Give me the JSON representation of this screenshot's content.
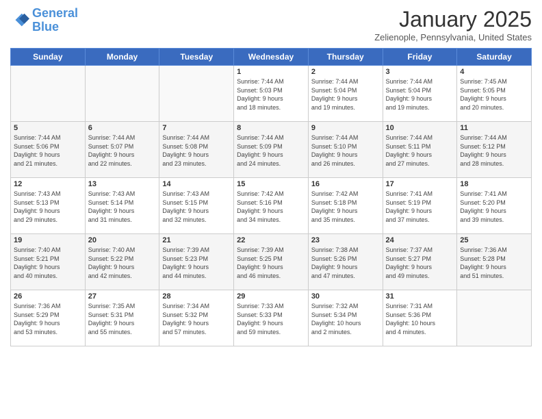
{
  "header": {
    "logo_line1": "General",
    "logo_line2": "Blue",
    "title": "January 2025",
    "location": "Zelienople, Pennsylvania, United States"
  },
  "days_of_week": [
    "Sunday",
    "Monday",
    "Tuesday",
    "Wednesday",
    "Thursday",
    "Friday",
    "Saturday"
  ],
  "weeks": [
    [
      {
        "day": "",
        "info": ""
      },
      {
        "day": "",
        "info": ""
      },
      {
        "day": "",
        "info": ""
      },
      {
        "day": "1",
        "info": "Sunrise: 7:44 AM\nSunset: 5:03 PM\nDaylight: 9 hours\nand 18 minutes."
      },
      {
        "day": "2",
        "info": "Sunrise: 7:44 AM\nSunset: 5:04 PM\nDaylight: 9 hours\nand 19 minutes."
      },
      {
        "day": "3",
        "info": "Sunrise: 7:44 AM\nSunset: 5:04 PM\nDaylight: 9 hours\nand 19 minutes."
      },
      {
        "day": "4",
        "info": "Sunrise: 7:45 AM\nSunset: 5:05 PM\nDaylight: 9 hours\nand 20 minutes."
      }
    ],
    [
      {
        "day": "5",
        "info": "Sunrise: 7:44 AM\nSunset: 5:06 PM\nDaylight: 9 hours\nand 21 minutes."
      },
      {
        "day": "6",
        "info": "Sunrise: 7:44 AM\nSunset: 5:07 PM\nDaylight: 9 hours\nand 22 minutes."
      },
      {
        "day": "7",
        "info": "Sunrise: 7:44 AM\nSunset: 5:08 PM\nDaylight: 9 hours\nand 23 minutes."
      },
      {
        "day": "8",
        "info": "Sunrise: 7:44 AM\nSunset: 5:09 PM\nDaylight: 9 hours\nand 24 minutes."
      },
      {
        "day": "9",
        "info": "Sunrise: 7:44 AM\nSunset: 5:10 PM\nDaylight: 9 hours\nand 26 minutes."
      },
      {
        "day": "10",
        "info": "Sunrise: 7:44 AM\nSunset: 5:11 PM\nDaylight: 9 hours\nand 27 minutes."
      },
      {
        "day": "11",
        "info": "Sunrise: 7:44 AM\nSunset: 5:12 PM\nDaylight: 9 hours\nand 28 minutes."
      }
    ],
    [
      {
        "day": "12",
        "info": "Sunrise: 7:43 AM\nSunset: 5:13 PM\nDaylight: 9 hours\nand 29 minutes."
      },
      {
        "day": "13",
        "info": "Sunrise: 7:43 AM\nSunset: 5:14 PM\nDaylight: 9 hours\nand 31 minutes."
      },
      {
        "day": "14",
        "info": "Sunrise: 7:43 AM\nSunset: 5:15 PM\nDaylight: 9 hours\nand 32 minutes."
      },
      {
        "day": "15",
        "info": "Sunrise: 7:42 AM\nSunset: 5:16 PM\nDaylight: 9 hours\nand 34 minutes."
      },
      {
        "day": "16",
        "info": "Sunrise: 7:42 AM\nSunset: 5:18 PM\nDaylight: 9 hours\nand 35 minutes."
      },
      {
        "day": "17",
        "info": "Sunrise: 7:41 AM\nSunset: 5:19 PM\nDaylight: 9 hours\nand 37 minutes."
      },
      {
        "day": "18",
        "info": "Sunrise: 7:41 AM\nSunset: 5:20 PM\nDaylight: 9 hours\nand 39 minutes."
      }
    ],
    [
      {
        "day": "19",
        "info": "Sunrise: 7:40 AM\nSunset: 5:21 PM\nDaylight: 9 hours\nand 40 minutes."
      },
      {
        "day": "20",
        "info": "Sunrise: 7:40 AM\nSunset: 5:22 PM\nDaylight: 9 hours\nand 42 minutes."
      },
      {
        "day": "21",
        "info": "Sunrise: 7:39 AM\nSunset: 5:23 PM\nDaylight: 9 hours\nand 44 minutes."
      },
      {
        "day": "22",
        "info": "Sunrise: 7:39 AM\nSunset: 5:25 PM\nDaylight: 9 hours\nand 46 minutes."
      },
      {
        "day": "23",
        "info": "Sunrise: 7:38 AM\nSunset: 5:26 PM\nDaylight: 9 hours\nand 47 minutes."
      },
      {
        "day": "24",
        "info": "Sunrise: 7:37 AM\nSunset: 5:27 PM\nDaylight: 9 hours\nand 49 minutes."
      },
      {
        "day": "25",
        "info": "Sunrise: 7:36 AM\nSunset: 5:28 PM\nDaylight: 9 hours\nand 51 minutes."
      }
    ],
    [
      {
        "day": "26",
        "info": "Sunrise: 7:36 AM\nSunset: 5:29 PM\nDaylight: 9 hours\nand 53 minutes."
      },
      {
        "day": "27",
        "info": "Sunrise: 7:35 AM\nSunset: 5:31 PM\nDaylight: 9 hours\nand 55 minutes."
      },
      {
        "day": "28",
        "info": "Sunrise: 7:34 AM\nSunset: 5:32 PM\nDaylight: 9 hours\nand 57 minutes."
      },
      {
        "day": "29",
        "info": "Sunrise: 7:33 AM\nSunset: 5:33 PM\nDaylight: 9 hours\nand 59 minutes."
      },
      {
        "day": "30",
        "info": "Sunrise: 7:32 AM\nSunset: 5:34 PM\nDaylight: 10 hours\nand 2 minutes."
      },
      {
        "day": "31",
        "info": "Sunrise: 7:31 AM\nSunset: 5:36 PM\nDaylight: 10 hours\nand 4 minutes."
      },
      {
        "day": "",
        "info": ""
      }
    ]
  ]
}
